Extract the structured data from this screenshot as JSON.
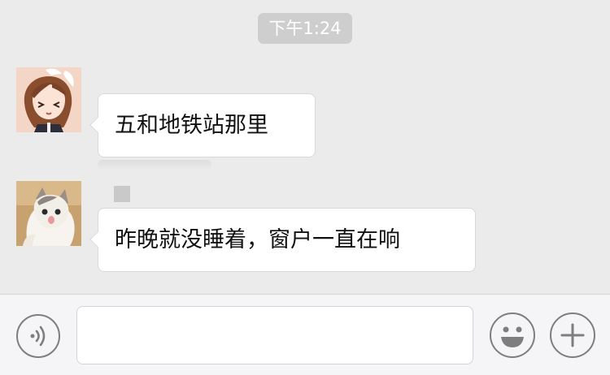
{
  "chat": {
    "timestamp": "下午1:24",
    "messages": [
      {
        "sender_avatar": "anime-girl-avatar",
        "text": "五和地铁站那里"
      },
      {
        "sender_avatar": "cat-avatar",
        "text": "昨晚就没睡着，窗户一直在响"
      }
    ]
  },
  "input_bar": {
    "text_value": "",
    "voice_icon": "voice-icon",
    "emoji_icon": "emoji-smile-icon",
    "add_icon": "plus-icon"
  },
  "colors": {
    "background": "#ebebeb",
    "bubble": "#ffffff",
    "timestamp_badge": "#cecece",
    "icon_stroke": "#7e7e7e"
  }
}
